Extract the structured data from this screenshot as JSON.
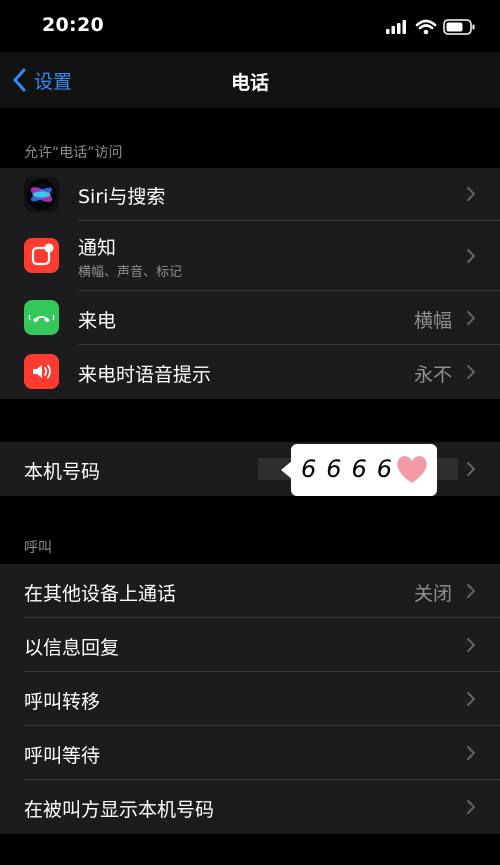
{
  "status_bar": {
    "time": "20:20",
    "icons": [
      "cellular-signal-icon",
      "wifi-icon",
      "battery-icon"
    ]
  },
  "nav": {
    "back_label": "设置",
    "title": "电话"
  },
  "sections": {
    "allow_access_header": "允许“电话”访问",
    "calls_header": "呼叫"
  },
  "access_items": [
    {
      "label": "Siri与搜索",
      "icon": "siri-icon",
      "value": ""
    },
    {
      "label": "通知",
      "sublabel": "横幅、声音、标记",
      "icon": "notification-icon",
      "value": ""
    },
    {
      "label": "来电",
      "icon": "phone-call-icon",
      "value": "横幅"
    },
    {
      "label": "来电时语音提示",
      "icon": "speaker-icon",
      "value": "永不"
    }
  ],
  "my_number": {
    "label": "本机号码",
    "sticker_text": "6666"
  },
  "call_items": [
    {
      "label": "在其他设备上通话",
      "value": "关闭"
    },
    {
      "label": "以信息回复",
      "value": ""
    },
    {
      "label": "呼叫转移",
      "value": ""
    },
    {
      "label": "呼叫等待",
      "value": ""
    },
    {
      "label": "在被叫方显示本机号码",
      "value": ""
    }
  ],
  "colors": {
    "background": "#000000",
    "group_background": "#1c1c1e",
    "accent_blue": "#2e8df5",
    "secondary_text": "#8e8e93",
    "siri_purple": "#5b3fd6",
    "notification_red": "#ff3b30",
    "phone_green": "#34c759",
    "sticker_heart_pink": "#f29ba4"
  }
}
